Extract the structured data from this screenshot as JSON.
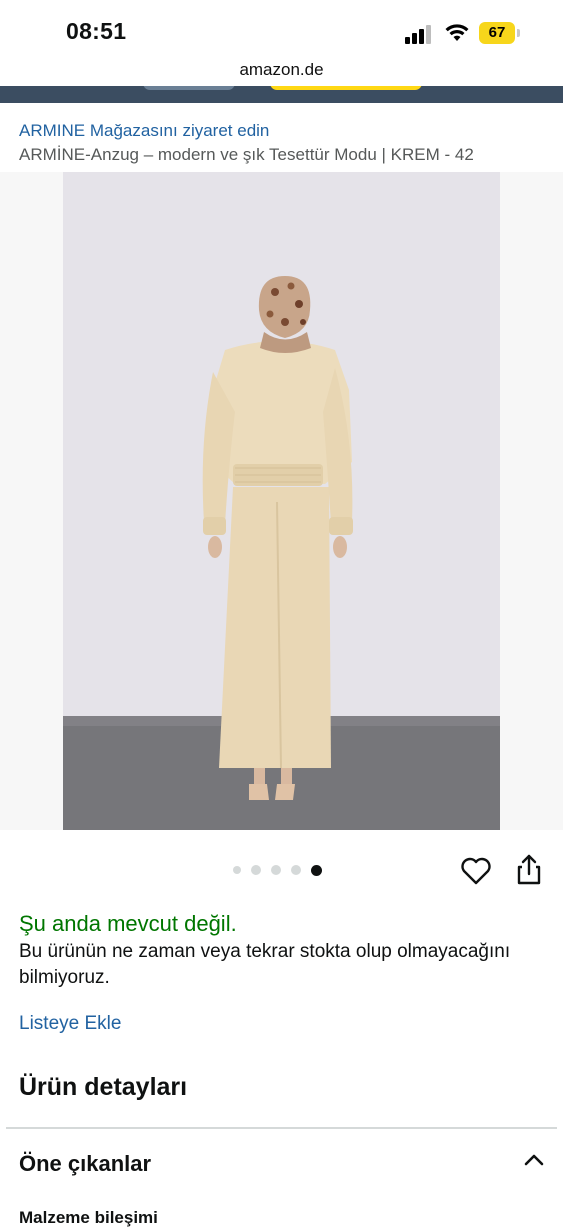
{
  "status_bar": {
    "time": "08:51",
    "battery": "67"
  },
  "browser": {
    "url": "amazon.de"
  },
  "product": {
    "store_link": "ARMINE Mağazasını ziyaret edin",
    "title": "ARMİNE-Anzug – modern ve şık Tesettür Modu | KREM - 42"
  },
  "gallery": {
    "image_count": 5,
    "active_index": 4
  },
  "icons": {
    "wishlist": "heart-icon",
    "share": "share-icon",
    "collapse": "chevron-up-icon"
  },
  "availability": {
    "status": "Şu anda mevcut değil.",
    "description": "Bu ürünün ne zaman veya tekrar stokta olup olmayacağını bilmiyoruz."
  },
  "actions": {
    "add_to_list": "Listeye Ekle"
  },
  "details": {
    "heading": "Ürün detayları",
    "highlights_heading": "Öne çıkanlar",
    "material_label": "Malzeme bileşimi"
  },
  "colors": {
    "link": "#2162a1",
    "available_status": "#007600",
    "accent": "#ffd814",
    "header": "#3b4d61"
  }
}
